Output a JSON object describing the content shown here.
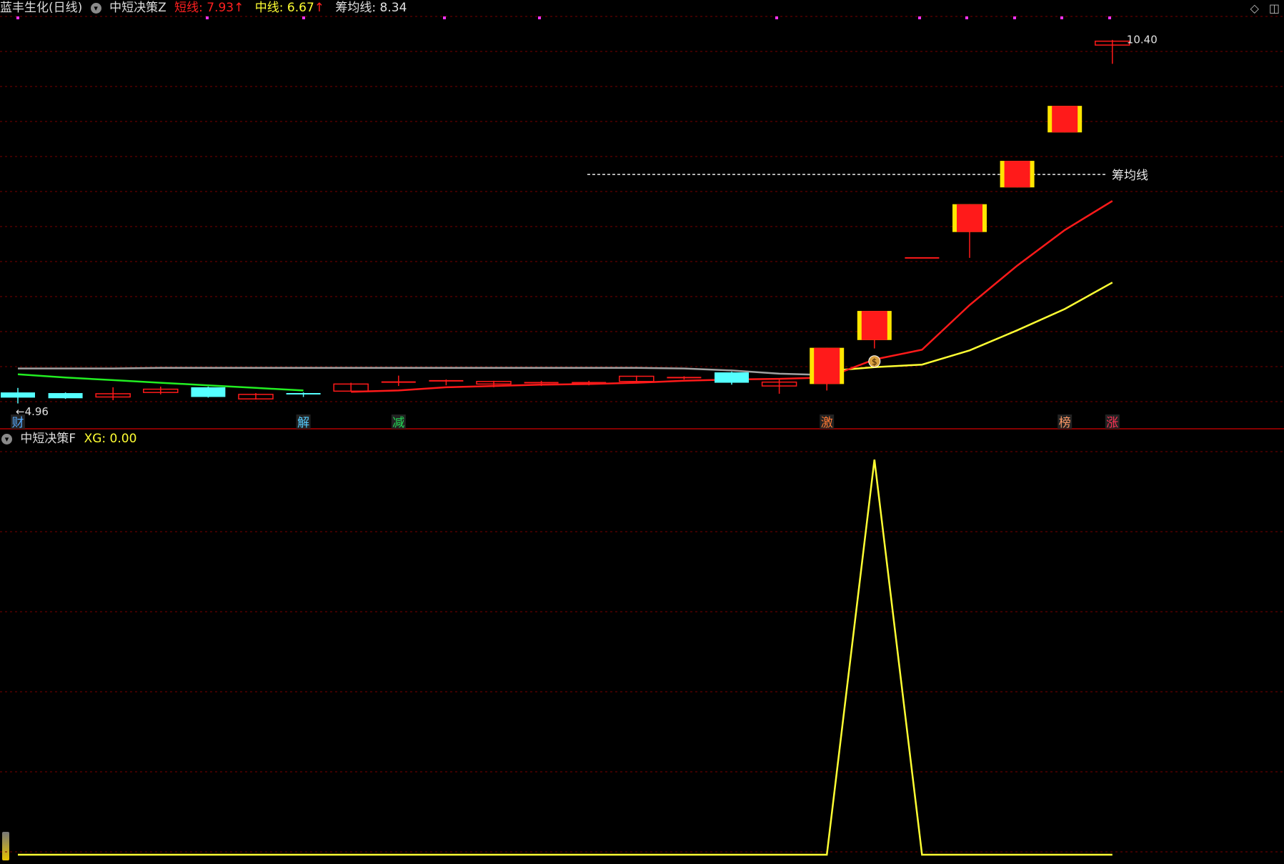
{
  "header": {
    "stock": "蓝丰生化(日线)",
    "indicator": "中短决策Z",
    "short_label": "短线: 7.93",
    "mid_label": "中线: 6.67",
    "chip_label": "筹均线: 8.34",
    "up_arrow": "↑"
  },
  "lower_header": {
    "indicator": "中短决策F",
    "xg_label": "XG: 0.00"
  },
  "icons": [
    "chevron-down-icon",
    "diamond-icon",
    "window-toggle-icon"
  ],
  "colors": {
    "background": "#000000",
    "up": "#ff1a1a",
    "up_fill": "#ffe600",
    "down": "#55ffff",
    "short_line": "#ff1a1a",
    "mid_line": "#ffff33",
    "gray_line": "#a0a0a0",
    "green_line": "#22ee22",
    "grid": "#7a0000",
    "magenta": "#ff33ff"
  },
  "chart_data": [
    {
      "type": "candlestick",
      "title": "中短决策Z",
      "ohlc": [
        {
          "o": 4.97,
          "c": 4.89,
          "h": 5.04,
          "l": 4.8
        },
        {
          "o": 4.96,
          "c": 4.88,
          "h": 4.97,
          "l": 4.87
        },
        {
          "o": 4.9,
          "c": 4.95,
          "h": 5.05,
          "l": 4.85
        },
        {
          "o": 4.97,
          "c": 5.02,
          "h": 5.06,
          "l": 4.94
        },
        {
          "o": 5.05,
          "c": 4.9,
          "h": 5.06,
          "l": 4.89
        },
        {
          "o": 4.87,
          "c": 4.94,
          "h": 4.96,
          "l": 4.86
        },
        {
          "o": 4.95,
          "c": 4.93,
          "h": 4.97,
          "l": 4.9
        },
        {
          "o": 4.99,
          "c": 5.1,
          "h": 5.12,
          "l": 4.99
        },
        {
          "o": 5.13,
          "c": 5.13,
          "h": 5.23,
          "l": 5.07
        },
        {
          "o": 5.15,
          "c": 5.15,
          "h": 5.17,
          "l": 5.08
        },
        {
          "o": 5.1,
          "c": 5.14,
          "h": 5.15,
          "l": 5.05
        },
        {
          "o": 5.12,
          "c": 5.12,
          "h": 5.15,
          "l": 5.07
        },
        {
          "o": 5.12,
          "c": 5.12,
          "h": 5.15,
          "l": 5.08
        },
        {
          "o": 5.14,
          "c": 5.22,
          "h": 5.23,
          "l": 5.14
        },
        {
          "o": 5.2,
          "c": 5.2,
          "h": 5.22,
          "l": 5.17
        },
        {
          "o": 5.28,
          "c": 5.12,
          "h": 5.29,
          "l": 5.09
        },
        {
          "o": 5.07,
          "c": 5.13,
          "h": 5.17,
          "l": 4.95
        },
        {
          "o": 5.1,
          "c": 5.66,
          "h": 5.66,
          "l": 5.0
        },
        {
          "o": 5.78,
          "c": 6.23,
          "h": 6.23,
          "l": 5.65
        },
        {
          "o": 7.05,
          "c": 7.05,
          "h": 7.05,
          "l": 7.05
        },
        {
          "o": 7.45,
          "c": 7.88,
          "h": 7.88,
          "l": 7.05
        },
        {
          "o": 8.14,
          "c": 8.55,
          "h": 8.55,
          "l": 8.14
        },
        {
          "o": 8.99,
          "c": 9.4,
          "h": 9.4,
          "l": 8.99
        },
        {
          "o": 10.34,
          "c": 10.4,
          "h": 10.42,
          "l": 10.05
        }
      ],
      "short_line": [
        null,
        null,
        null,
        null,
        null,
        null,
        null,
        4.98,
        5.0,
        5.05,
        5.07,
        5.09,
        5.1,
        5.12,
        5.15,
        5.17,
        5.18,
        5.2,
        5.48,
        5.63,
        6.32,
        6.93,
        7.48,
        7.93
      ],
      "mid_line": [
        null,
        null,
        null,
        null,
        null,
        null,
        null,
        null,
        null,
        null,
        null,
        null,
        null,
        null,
        null,
        null,
        null,
        5.3,
        5.36,
        5.4,
        5.62,
        5.93,
        6.26,
        6.67
      ],
      "gray_line": [
        5.34,
        5.34,
        5.34,
        5.35,
        5.35,
        5.35,
        5.35,
        5.35,
        5.35,
        5.35,
        5.35,
        5.35,
        5.35,
        5.35,
        5.34,
        5.31,
        5.26,
        5.24
      ],
      "green_line": [
        5.25,
        5.2,
        5.16,
        5.12,
        5.08,
        5.04,
        5.0
      ],
      "chip_avg": 8.34,
      "chip_label": "筹均线",
      "high_label": "10.40",
      "low_label": "4.96",
      "markers": [
        {
          "i": 0,
          "text": "财",
          "color": "#55aaff"
        },
        {
          "i": 6,
          "text": "解",
          "color": "#55ccff"
        },
        {
          "i": 8,
          "text": "减",
          "color": "#22dd55"
        },
        {
          "i": 17,
          "text": "激",
          "color": "#ff7733"
        },
        {
          "i": 22,
          "text": "榜",
          "color": "#ff9966"
        },
        {
          "i": 23,
          "text": "涨",
          "color": "#ff3355"
        }
      ],
      "ylim": [
        4.85,
        10.65
      ]
    },
    {
      "type": "line",
      "title": "中短决策F",
      "values": [
        0,
        0,
        0,
        0,
        0,
        0,
        0,
        0,
        0,
        0,
        0,
        0,
        0,
        0,
        0,
        0,
        0,
        0,
        1,
        0,
        0,
        0,
        0,
        0
      ],
      "ylim": [
        0,
        1.02
      ]
    }
  ]
}
